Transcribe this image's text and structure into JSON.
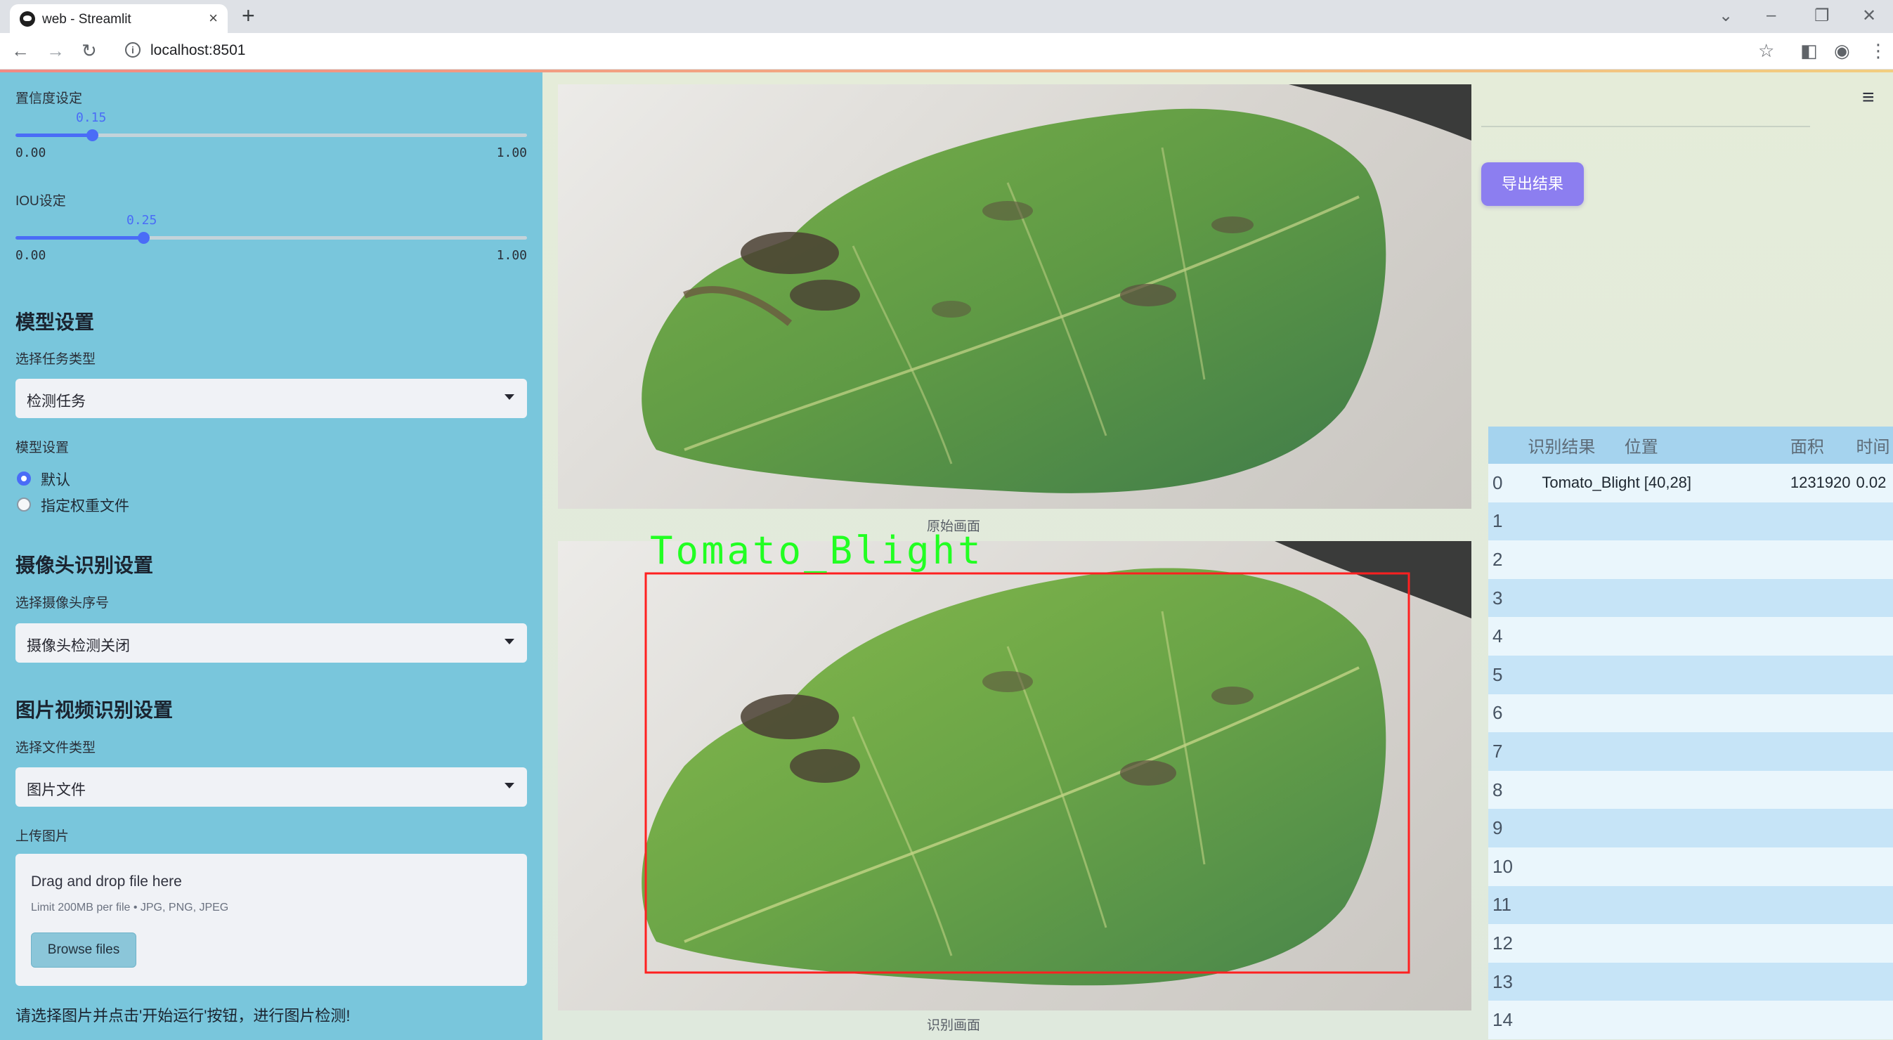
{
  "browser": {
    "tab_title": "web - Streamlit",
    "tab_close": "×",
    "new_tab": "+",
    "url": "localhost:8501"
  },
  "sidebar": {
    "confidence": {
      "label": "置信度设定",
      "value": "0.15",
      "min": "0.00",
      "max": "1.00",
      "fraction": 0.15
    },
    "iou": {
      "label": "IOU设定",
      "value": "0.25",
      "min": "0.00",
      "max": "1.00",
      "fraction": 0.25
    },
    "model_section": {
      "heading": "模型设置",
      "task_label": "选择任务类型",
      "task_value": "检测任务",
      "weights_label": "模型设置",
      "radio_default": "默认",
      "radio_custom": "指定权重文件",
      "selected": "默认"
    },
    "camera_section": {
      "heading": "摄像头识别设置",
      "camera_label": "选择摄像头序号",
      "camera_value": "摄像头检测关闭"
    },
    "media_section": {
      "heading": "图片视频识别设置",
      "file_type_label": "选择文件类型",
      "file_type_value": "图片文件",
      "upload_label": "上传图片",
      "drop_text": "Drag and drop file here",
      "limit_text": "Limit 200MB per file • JPG, PNG, JPEG",
      "browse_button": "Browse files"
    },
    "hint": "请选择图片并点击'开始运行'按钮，进行图片检测!"
  },
  "main": {
    "original_caption": "原始画面",
    "result_caption": "识别画面",
    "detection_label": "Tomato_Blight",
    "export_button": "导出结果"
  },
  "table": {
    "headers": [
      "",
      "识别结果",
      "位置",
      "面积",
      "时间"
    ],
    "rows": [
      {
        "idx": "0",
        "result": "Tomato_Blight",
        "position": "[40,28]",
        "area": "1231920",
        "time": "0.02"
      },
      {
        "idx": "1"
      },
      {
        "idx": "2"
      },
      {
        "idx": "3"
      },
      {
        "idx": "4"
      },
      {
        "idx": "5"
      },
      {
        "idx": "6"
      },
      {
        "idx": "7"
      },
      {
        "idx": "8"
      },
      {
        "idx": "9"
      },
      {
        "idx": "10"
      },
      {
        "idx": "11"
      },
      {
        "idx": "12"
      },
      {
        "idx": "13"
      },
      {
        "idx": "14"
      }
    ]
  },
  "colors": {
    "sidebar_bg": "#79c6dc",
    "accent": "#4a6cf7",
    "export_button": "#8c7ef0",
    "detection_box": "#ff2020",
    "detection_label": "#22ff22"
  },
  "icons": [
    "streamlit-favicon",
    "back-icon",
    "forward-icon",
    "reload-icon",
    "info-icon",
    "star-icon",
    "sidebar-toggle-icon",
    "profile-icon",
    "kebab-menu-icon",
    "hamburger-menu-icon"
  ]
}
